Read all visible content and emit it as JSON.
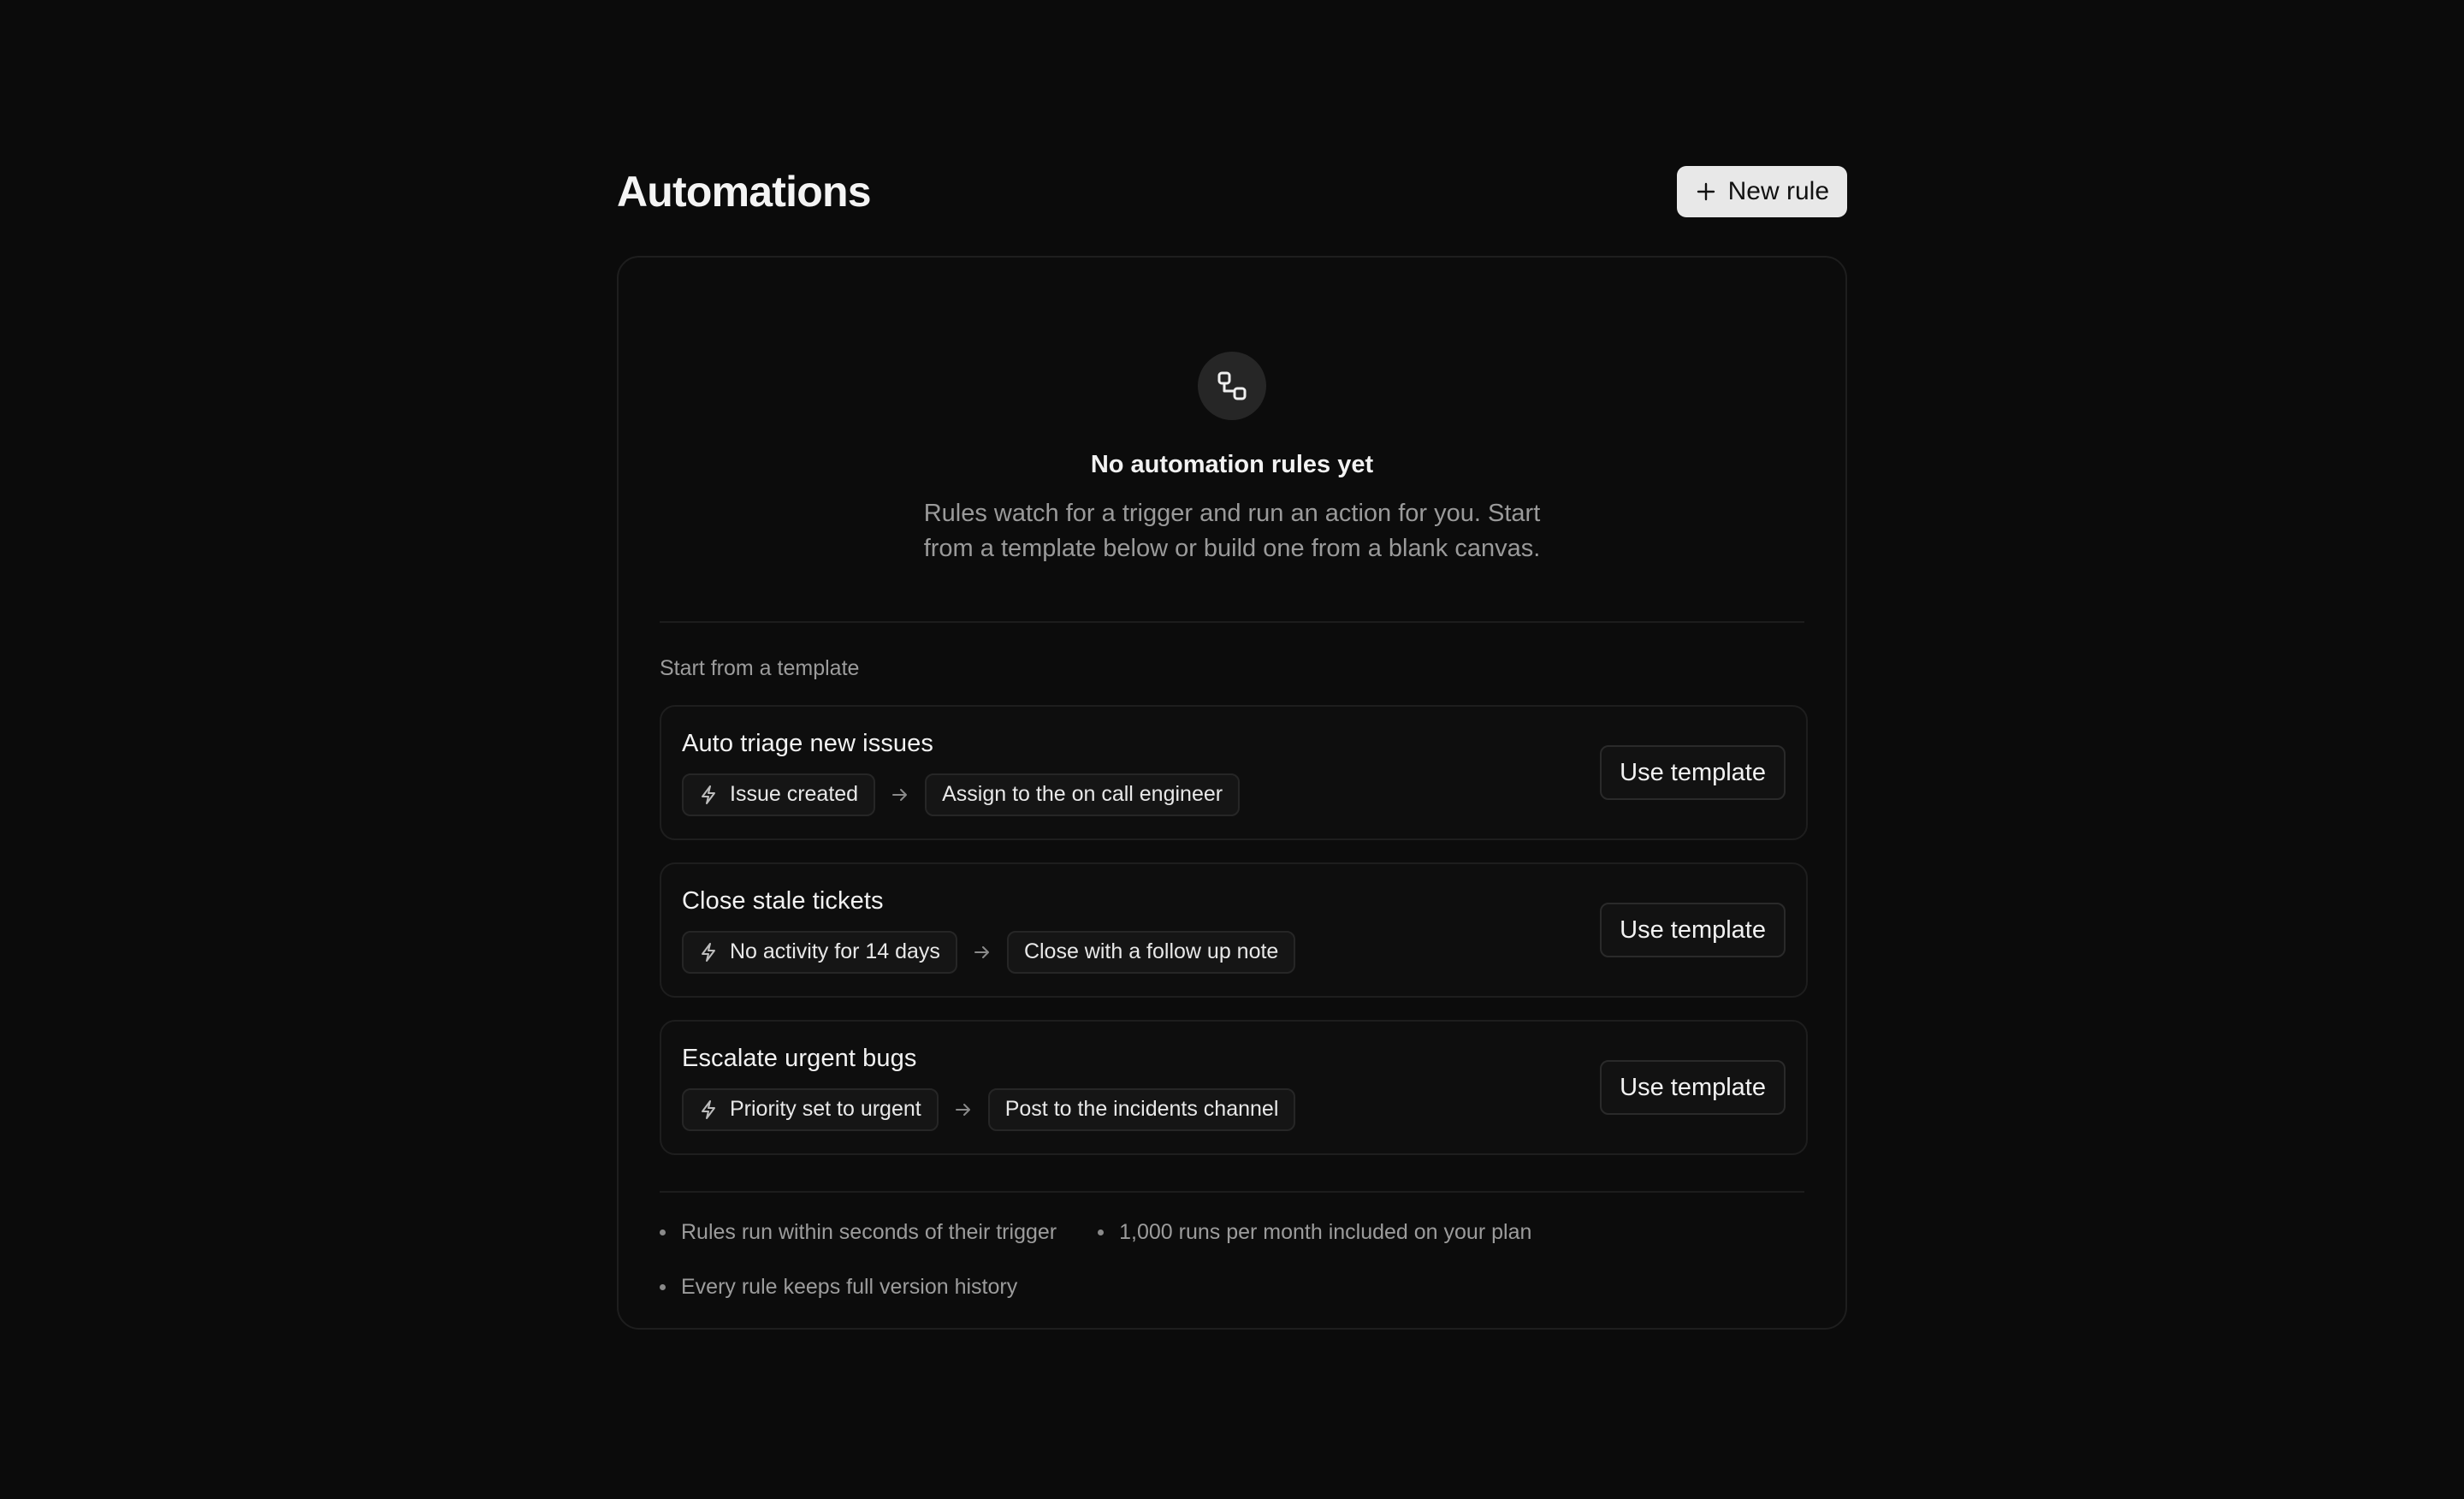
{
  "header": {
    "title": "Automations",
    "new_rule_label": "New rule"
  },
  "empty_state": {
    "icon": "workflow-icon",
    "title": "No automation rules yet",
    "description": "Rules watch for a trigger and run an action for you. Start from a template below or build one from a blank canvas."
  },
  "templates": {
    "section_label": "Start from a template",
    "use_label": "Use template",
    "items": [
      {
        "name": "Auto triage new issues",
        "trigger": "Issue created",
        "action": "Assign to the on call engineer"
      },
      {
        "name": "Close stale tickets",
        "trigger": "No activity for 14 days",
        "action": "Close with a follow up note"
      },
      {
        "name": "Escalate urgent bugs",
        "trigger": "Priority set to urgent",
        "action": "Post to the incidents channel"
      }
    ]
  },
  "notes": [
    "Rules run within seconds of their trigger",
    "1,000 runs per month included on your plan",
    "Every rule keeps full version history"
  ],
  "colors": {
    "background": "#0b0b0b",
    "primary_button": "#e8e8e8",
    "muted_text": "#9a9a9a"
  }
}
